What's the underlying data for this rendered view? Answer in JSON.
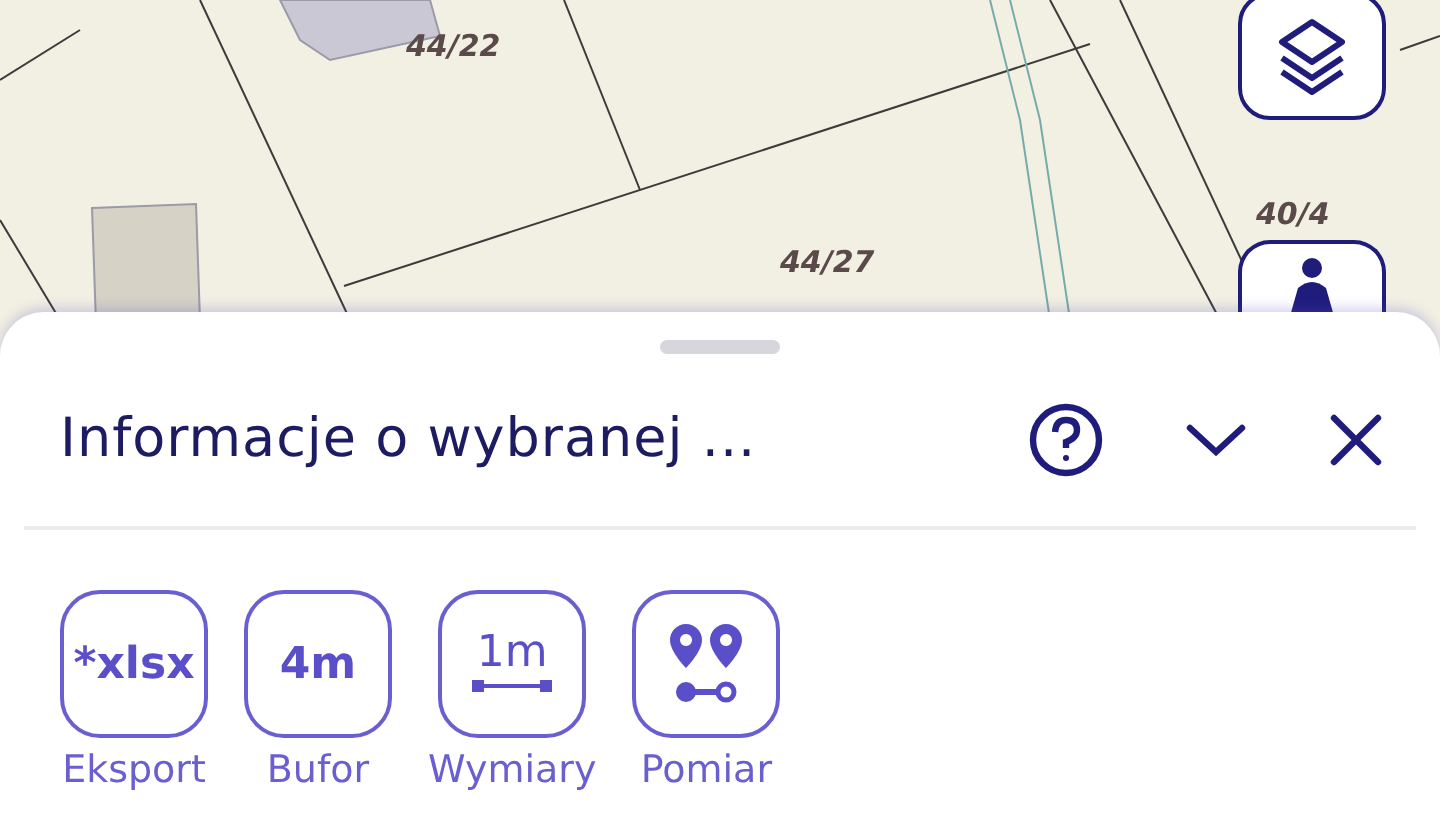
{
  "map": {
    "parcel_labels": [
      "44/22",
      "44/27",
      "40/4"
    ]
  },
  "sheet": {
    "title": "Informacje o wybranej ...",
    "tools": [
      {
        "kind": "text",
        "icon_text": "*xlsx",
        "label": "Eksport"
      },
      {
        "kind": "text",
        "icon_text": "4m",
        "label": "Bufor"
      },
      {
        "kind": "dimension",
        "icon_text": "1m",
        "label": "Wymiary"
      },
      {
        "kind": "pins",
        "label": "Pomiar"
      }
    ]
  }
}
